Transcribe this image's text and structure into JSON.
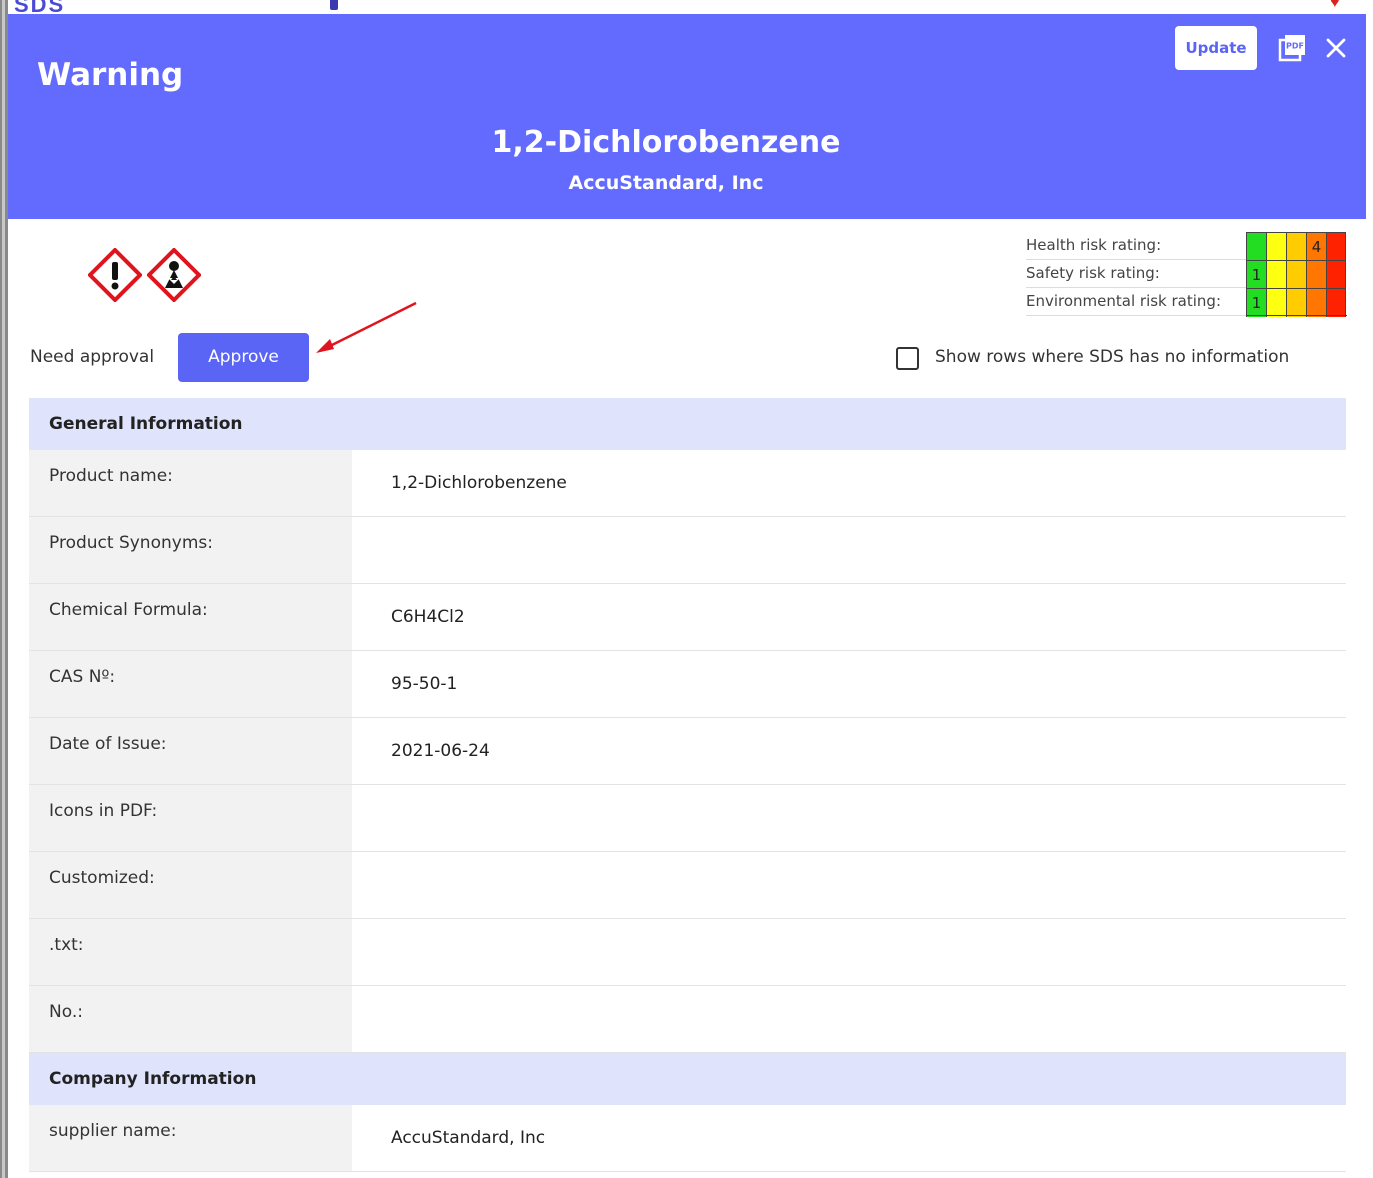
{
  "background": {
    "logo_text": "SDS"
  },
  "header": {
    "warning_title": "Warning",
    "product_title": "1,2-Dichlorobenzene",
    "product_subtitle": "AccuStandard, Inc",
    "update_label": "Update",
    "pdf_icon": "pdf-icon",
    "close_icon": "close-icon",
    "color": "#636bff"
  },
  "hazard_icons": [
    "exclamation-mark-pictogram",
    "health-hazard-pictogram"
  ],
  "ratings": [
    {
      "label": "Health risk rating:",
      "value": "4"
    },
    {
      "label": "Safety risk rating:",
      "value": "1"
    },
    {
      "label": "Environmental risk rating:",
      "value": "1"
    }
  ],
  "rating_colors": [
    "#22dd22",
    "#ffff11",
    "#ffcc00",
    "#ff7700",
    "#ff2200"
  ],
  "approval": {
    "label": "Need approval",
    "button_label": "Approve"
  },
  "show_rows": {
    "label": "Show rows where SDS has no information",
    "checked": false
  },
  "sections": [
    {
      "title": "General Information",
      "rows": [
        {
          "label": "Product name:",
          "value": "1,2-Dichlorobenzene"
        },
        {
          "label": "Product Synonyms:",
          "value": ""
        },
        {
          "label": "Chemical Formula:",
          "value": "C6H4Cl2"
        },
        {
          "label": "CAS Nº:",
          "value": "95-50-1"
        },
        {
          "label": "Date of Issue:",
          "value": "2021-06-24"
        },
        {
          "label": "Icons in PDF:",
          "value": ""
        },
        {
          "label": "Customized:",
          "value": ""
        },
        {
          "label": ".txt:",
          "value": ""
        },
        {
          "label": "No.:",
          "value": ""
        }
      ]
    },
    {
      "title": "Company Information",
      "rows": [
        {
          "label": "supplier name:",
          "value": "AccuStandard, Inc"
        }
      ]
    }
  ]
}
